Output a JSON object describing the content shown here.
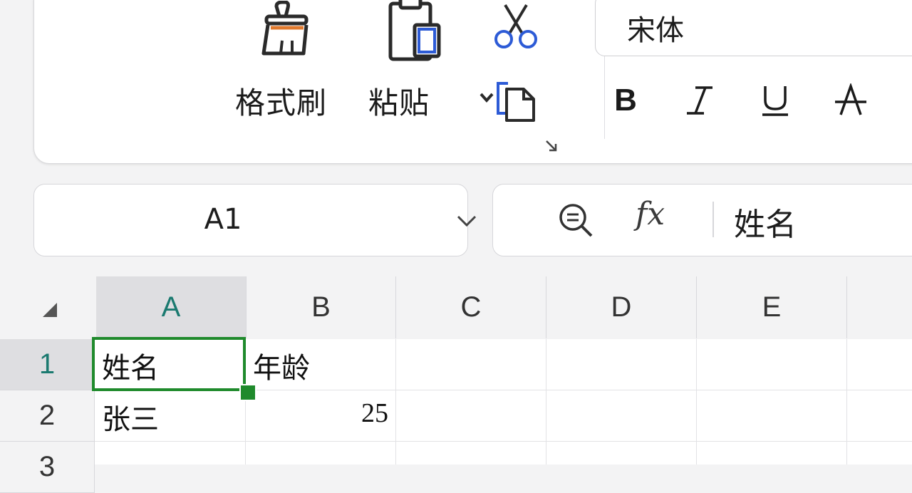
{
  "ribbon": {
    "format_painter_label": "格式刷",
    "paste_label": "粘贴",
    "font_name": "宋体",
    "icons": [
      "format-painter-icon",
      "clipboard-icon",
      "scissors-icon",
      "copy-icon",
      "dialog-launcher-icon",
      "bold-icon",
      "italic-icon",
      "underline-icon",
      "strikethrough-icon"
    ]
  },
  "namebox": {
    "cell_ref": "A1"
  },
  "formula_bar": {
    "fx_label": "fx",
    "value": "姓名"
  },
  "sheet": {
    "columns": [
      "A",
      "B",
      "C",
      "D",
      "E"
    ],
    "rows": [
      "1",
      "2",
      "3"
    ],
    "cells": {
      "A1": "姓名",
      "B1": "年龄",
      "A2": "张三",
      "B2": "25"
    },
    "active_cell": "A1"
  },
  "colors": {
    "selection": "#1f8a2c",
    "active_header_text": "#1b7a70",
    "accent_blue": "#2d5bd6",
    "accent_orange": "#e07a2e"
  }
}
